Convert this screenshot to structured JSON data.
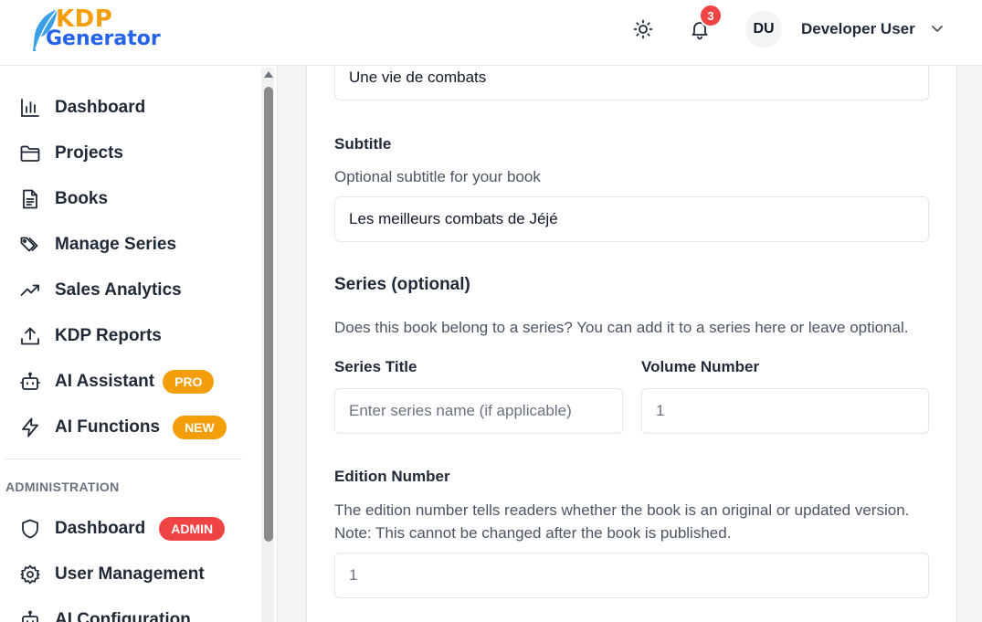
{
  "header": {
    "logo_top": "KDP",
    "logo_bottom": "Generator",
    "notification_count": "3",
    "user_initials": "DU",
    "user_name": "Developer User"
  },
  "sidebar": {
    "items": [
      {
        "label": "Dashboard",
        "icon": "bar-chart-icon"
      },
      {
        "label": "Projects",
        "icon": "folder-icon"
      },
      {
        "label": "Books",
        "icon": "document-icon"
      },
      {
        "label": "Manage Series",
        "icon": "tags-icon"
      },
      {
        "label": "Sales Analytics",
        "icon": "trending-up-icon"
      },
      {
        "label": "KDP Reports",
        "icon": "upload-icon"
      },
      {
        "label": "AI Assistant",
        "icon": "robot-icon",
        "badge": "PRO"
      },
      {
        "label": "AI Functions",
        "icon": "lightning-icon",
        "badge": "NEW"
      }
    ],
    "admin_section_label": "ADMINISTRATION",
    "admin_items": [
      {
        "label": "Dashboard",
        "icon": "shield-icon",
        "badge": "ADMIN"
      },
      {
        "label": "User Management",
        "icon": "gear-icon"
      },
      {
        "label": "AI Configuration",
        "icon": "robot-icon"
      }
    ]
  },
  "form": {
    "title_value": "Une vie de combats",
    "subtitle_label": "Subtitle",
    "subtitle_helper": "Optional subtitle for your book",
    "subtitle_value": "Les meilleurs combats de Jéjé",
    "series_heading": "Series (optional)",
    "series_helper": "Does this book belong to a series? You can add it to a series here or leave optional.",
    "series_title_label": "Series Title",
    "series_title_placeholder": "Enter series name (if applicable)",
    "volume_label": "Volume Number",
    "volume_value": "1",
    "edition_label": "Edition Number",
    "edition_helper_1": "The edition number tells readers whether the book is an original or updated version.",
    "edition_helper_2": "Note: This cannot be changed after the book is published.",
    "edition_value": "1"
  },
  "colors": {
    "accent_orange": "#f59e0b",
    "brand_blue": "#2563eb",
    "admin_red": "#ef4444"
  }
}
